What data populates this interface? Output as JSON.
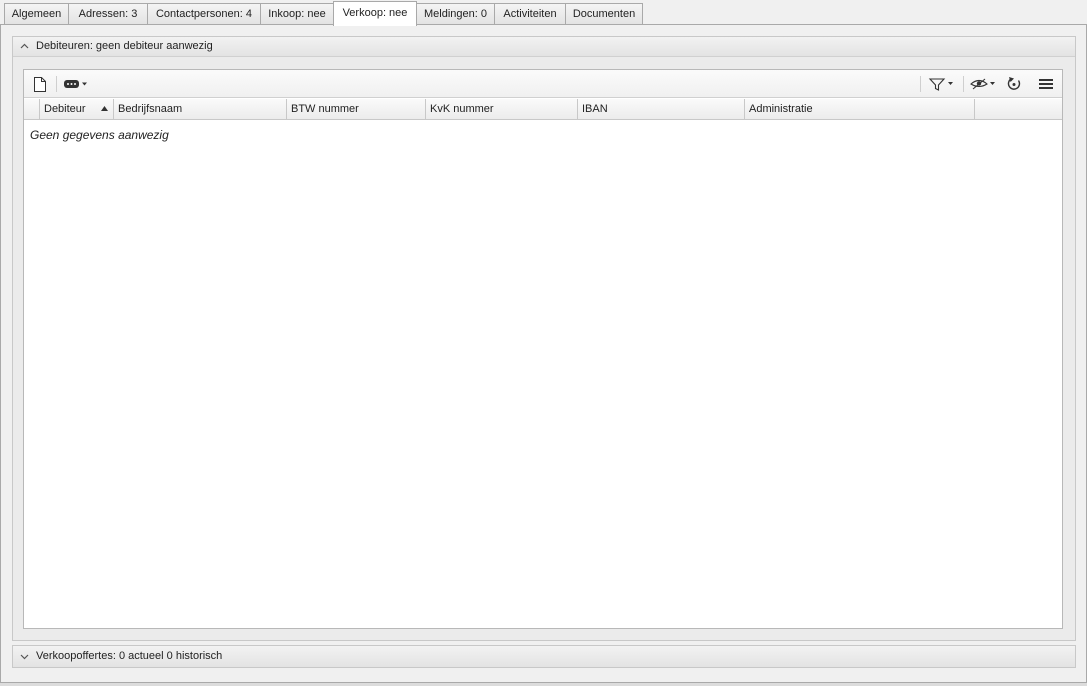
{
  "tabs": [
    {
      "label": "Algemeen"
    },
    {
      "label": "Adressen: 3"
    },
    {
      "label": "Contactpersonen: 4"
    },
    {
      "label": "Inkoop: nee"
    },
    {
      "label": "Verkoop: nee"
    },
    {
      "label": "Meldingen: 0"
    },
    {
      "label": "Activiteiten"
    },
    {
      "label": "Documenten"
    }
  ],
  "active_tab": "Verkoop: nee",
  "debiteuren_panel": {
    "title": "Debiteuren: geen debiteur aanwezig",
    "columns": [
      "Debiteur",
      "Bedrijfsnaam",
      "BTW nummer",
      "KvK nummer",
      "IBAN",
      "Administratie"
    ],
    "sorted_column": "Debiteur",
    "sort_direction": "ascending",
    "empty_message": "Geen gegevens aanwezig"
  },
  "verkoopoffertes_panel": {
    "title": "Verkoopoffertes: 0 actueel 0 historisch"
  },
  "toolbar_icons": [
    "new-document-icon",
    "more-actions-icon",
    "filter-icon",
    "view-icon",
    "refresh-icon",
    "menu-icon"
  ]
}
